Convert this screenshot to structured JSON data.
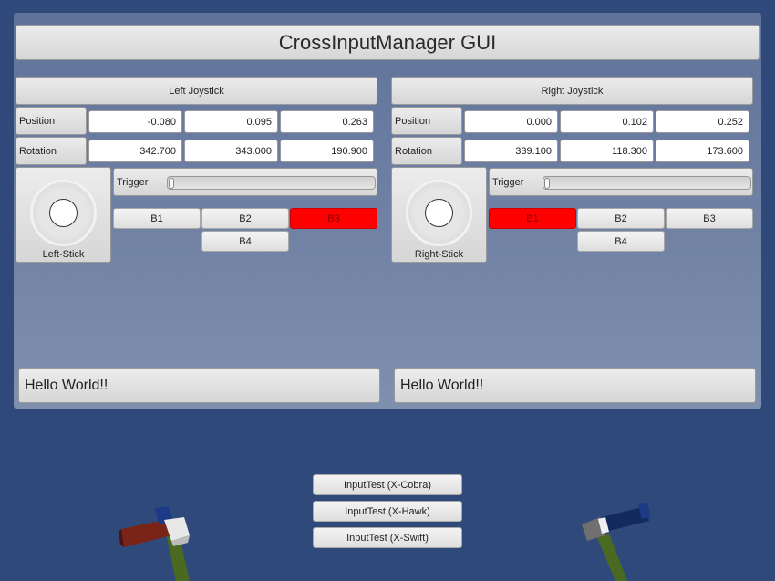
{
  "title": "CrossInputManager GUI",
  "joysticks": [
    {
      "header": "Left Joystick",
      "position_label": "Position",
      "position": [
        "-0.080",
        "0.095",
        "0.263"
      ],
      "rotation_label": "Rotation",
      "rotation": [
        "342.700",
        "343.000",
        "190.900"
      ],
      "stick_label": "Left-Stick",
      "trigger_label": "Trigger",
      "trigger_value": 0,
      "buttons": [
        {
          "label": "B1",
          "pressed": false
        },
        {
          "label": "B2",
          "pressed": false
        },
        {
          "label": "B3",
          "pressed": true
        },
        {
          "label": "B4",
          "pressed": false
        }
      ],
      "message": "Hello World!!"
    },
    {
      "header": "Right Joystick",
      "position_label": "Position",
      "position": [
        "0.000",
        "0.102",
        "0.252"
      ],
      "rotation_label": "Rotation",
      "rotation": [
        "339.100",
        "118.300",
        "173.600"
      ],
      "stick_label": "Right-Stick",
      "trigger_label": "Trigger",
      "trigger_value": 0,
      "buttons": [
        {
          "label": "B1",
          "pressed": true
        },
        {
          "label": "B2",
          "pressed": false
        },
        {
          "label": "B3",
          "pressed": false
        },
        {
          "label": "B4",
          "pressed": false
        }
      ],
      "message": "Hello World!!"
    }
  ],
  "test_buttons": [
    "InputTest (X-Cobra)",
    "InputTest (X-Hawk)",
    "InputTest (X-Swift)"
  ],
  "colors": {
    "background": "#2f4a7a",
    "pressed_button": "#ff0000"
  }
}
